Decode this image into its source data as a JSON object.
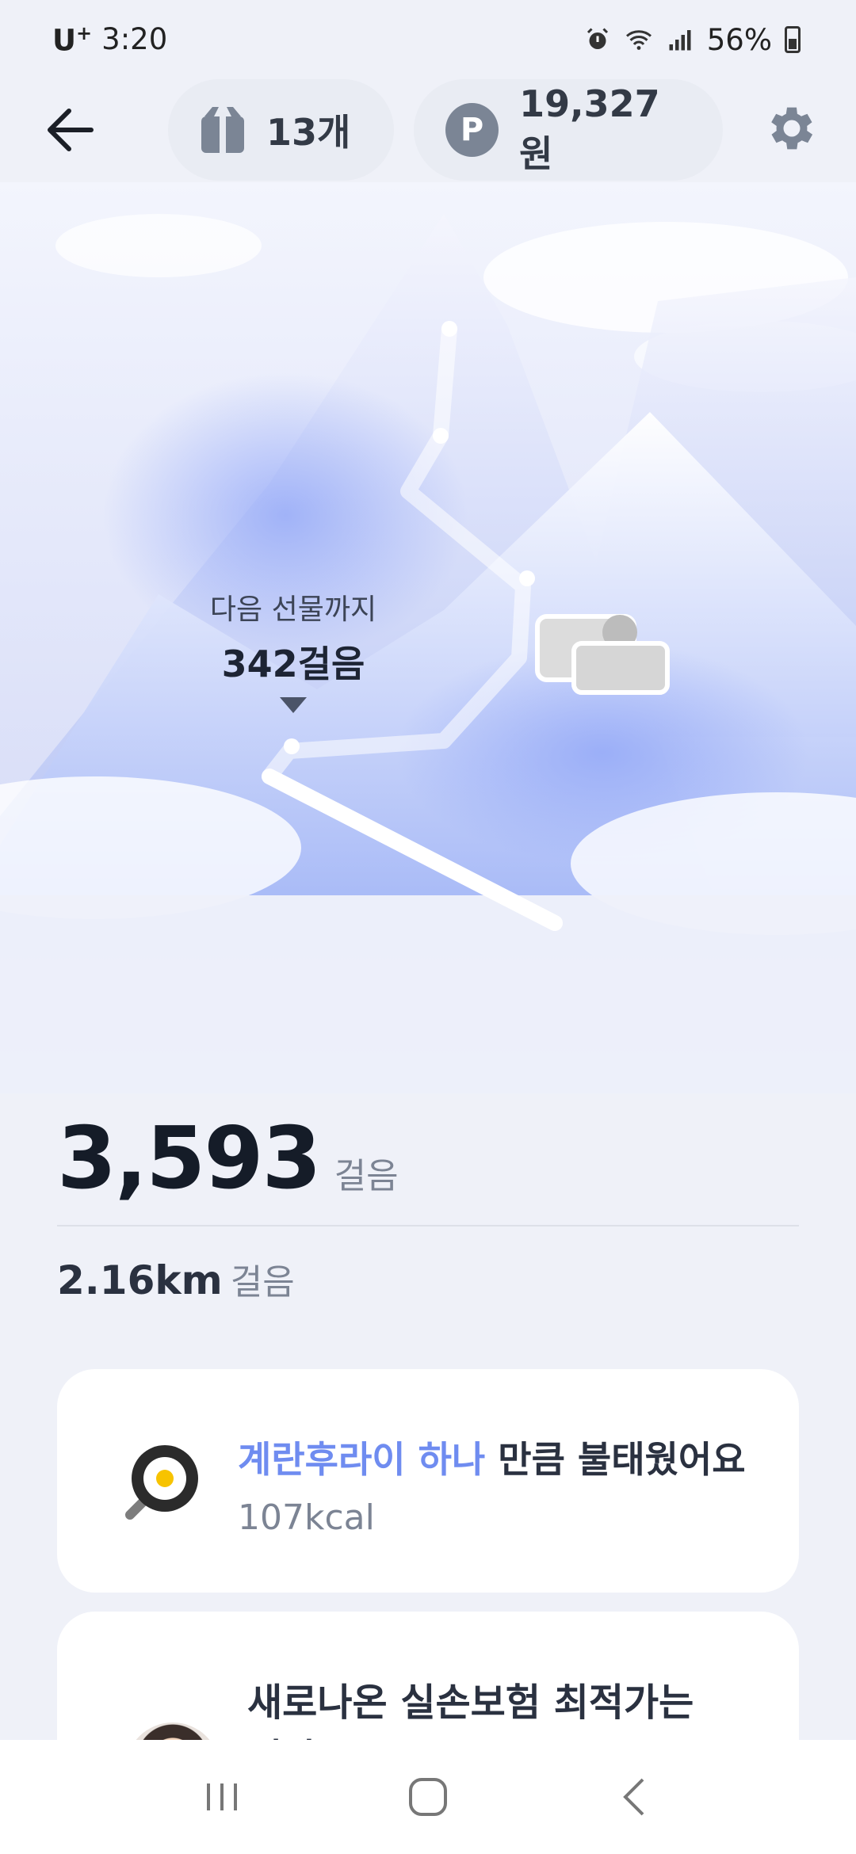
{
  "status_bar": {
    "carrier": "U",
    "carrier_sup": "+",
    "time": "3:20",
    "battery": "56%"
  },
  "header": {
    "gift_count": "13개",
    "points": "19,327원",
    "points_icon_letter": "P"
  },
  "hero": {
    "next_gift_label": "다음 선물까지",
    "next_gift_steps": "342걸음"
  },
  "summary": {
    "steps": "3,593",
    "steps_unit": "걸음",
    "distance": "2.16km",
    "distance_unit": "걸음"
  },
  "calorie_card": {
    "highlight": "계란후라이 하나",
    "rest": " 만큼 불태웠어요",
    "value": "107kcal"
  },
  "ad_card": {
    "title": "새로나온 실손보험 최적가는 얼마?"
  },
  "colors": {
    "accent": "#6f8cf0",
    "background": "#eff1f8"
  }
}
